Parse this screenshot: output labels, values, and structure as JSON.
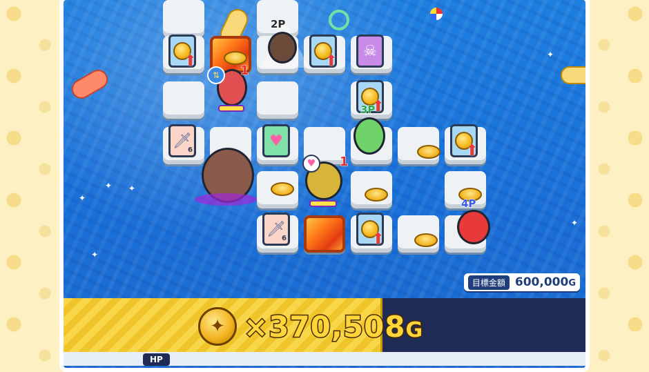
{
  "board": {
    "players": [
      {
        "id": "1p",
        "label": "1"
      },
      {
        "id": "2p",
        "label": "2P"
      },
      {
        "id": "3p",
        "label": "3P"
      },
      {
        "id": "4p",
        "label": "4P"
      },
      {
        "id": "boss",
        "label": "1"
      }
    ],
    "sword_card_values": [
      "6",
      "6"
    ]
  },
  "hud": {
    "currency_icon": "coin-icon",
    "multiplier": "×",
    "amount": "370,508",
    "unit": "G",
    "target_label": "目標金額",
    "target_value": "600,000",
    "target_unit": "G",
    "hp_label": "HP"
  },
  "colors": {
    "water": "#1e7fe0",
    "hud_gold": "#f7d64a",
    "hud_navy": "#1f2a55"
  }
}
